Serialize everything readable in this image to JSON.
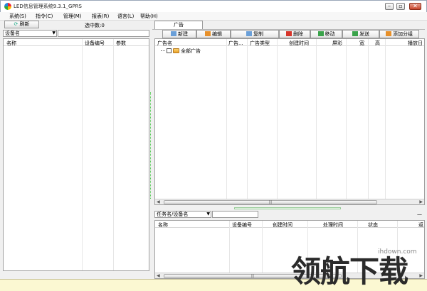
{
  "window": {
    "title": "LED信息管理系统9.3.1_GPRS",
    "buttons": [
      "–",
      "▫",
      "✕"
    ]
  },
  "menu": [
    "系统(S)",
    "指令(C)",
    "管理(M)",
    "报表(R)",
    "语言(L)",
    "帮助(H)"
  ],
  "left_panel": {
    "refresh_label": "刷新",
    "selected_count": "选中数:0",
    "filter_combo": "设备名",
    "columns": [
      "名称",
      "设备编号",
      "参数"
    ]
  },
  "ads_panel": {
    "tab_label": "广告",
    "toolbar": [
      {
        "label": "新建",
        "icon": "new-icon",
        "color": "#6a9fd8"
      },
      {
        "label": "编辑",
        "icon": "edit-icon",
        "color": "#e7902a"
      },
      {
        "label": "复制",
        "icon": "copy-icon",
        "color": "#6a9fd8"
      },
      {
        "label": "删除",
        "icon": "delete-icon",
        "color": "#d6342a"
      },
      {
        "label": "移动",
        "icon": "move-icon",
        "color": "#3aa34a"
      },
      {
        "label": "发送",
        "icon": "send-icon",
        "color": "#3aa34a"
      },
      {
        "label": "添加分组",
        "icon": "add-group-icon",
        "color": "#e7902a"
      }
    ],
    "columns": [
      "广告名",
      "广告...",
      "广告类型",
      "创建时间",
      "屏彩",
      "宽",
      "高",
      "播放日"
    ],
    "tree_root": "全部广告"
  },
  "task_panel": {
    "filter_combo": "任务名/设备名",
    "columns": [
      "名称",
      "设备编号",
      "创建时间",
      "处理时间",
      "状态",
      "返"
    ]
  },
  "watermark": {
    "url": "ihdown.com",
    "text": "领航下载"
  }
}
